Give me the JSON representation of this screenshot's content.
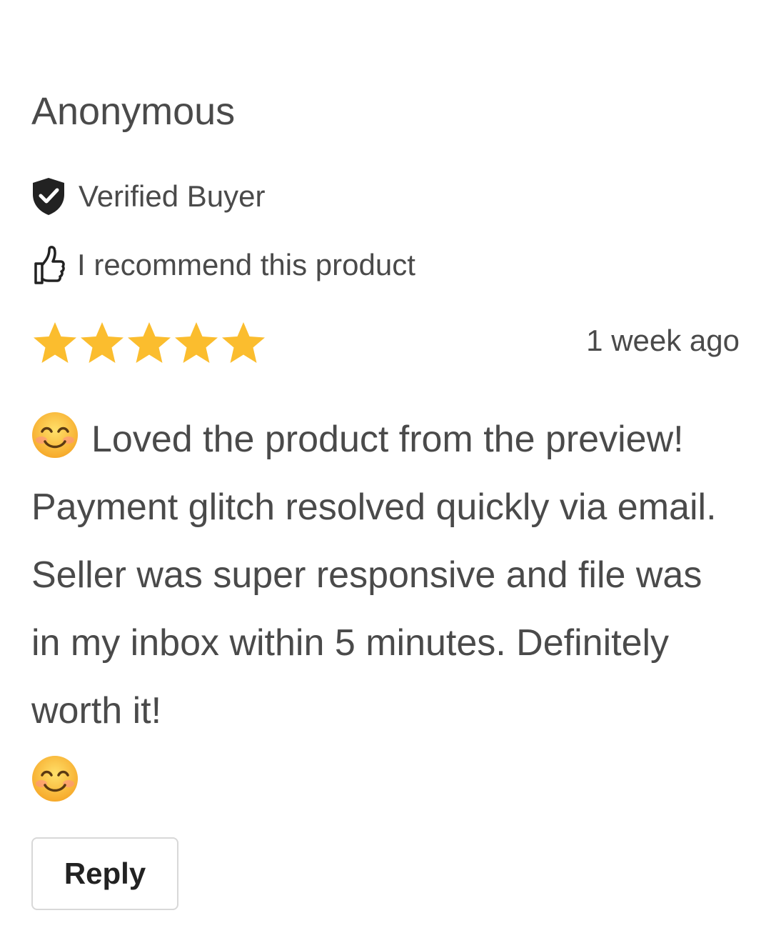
{
  "review": {
    "reviewer_name": "Anonymous",
    "verified_label": "Verified Buyer",
    "recommend_label": "I recommend this product",
    "rating": 5,
    "rating_max": 5,
    "timestamp": "1 week ago",
    "body_text": "Loved the product from the preview! Payment glitch resolved quickly via email. Seller was super responsive and file was in my inbox within 5 minutes. Definitely worth it!",
    "emoji_lead": "smiling-face-emoji",
    "emoji_tail": "smiling-face-emoji",
    "reply_label": "Reply"
  },
  "icons": {
    "verified": "shield-check-icon",
    "recommend": "thumbs-up-icon",
    "star": "star-icon"
  },
  "colors": {
    "text": "#4a4a4a",
    "star": "#fbbd2e",
    "shield": "#222222",
    "button_border": "#d8d8d8"
  }
}
